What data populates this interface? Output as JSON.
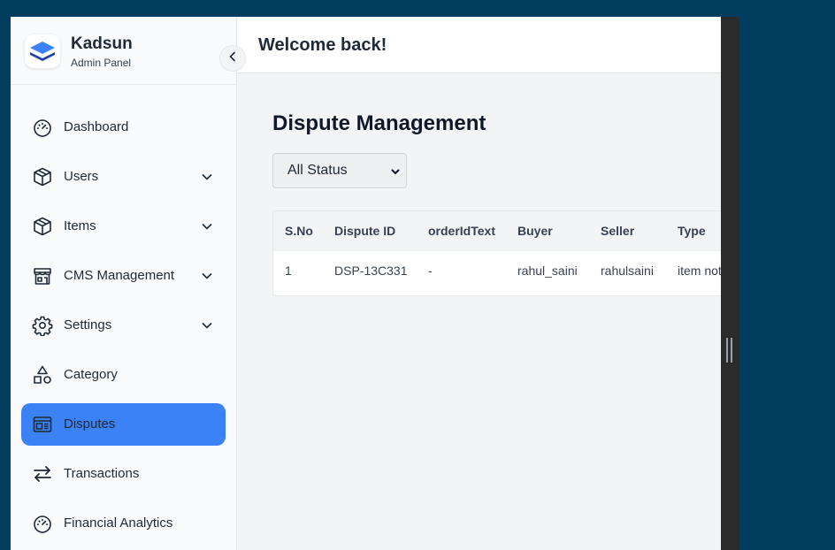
{
  "brand": {
    "name": "Kadsun",
    "subtitle": "Admin Panel"
  },
  "sidebar": {
    "items": [
      {
        "label": "Dashboard",
        "icon": "gauge-icon",
        "has_submenu": false,
        "active": false
      },
      {
        "label": "Users",
        "icon": "box-icon",
        "has_submenu": true,
        "active": false
      },
      {
        "label": "Items",
        "icon": "box-icon",
        "has_submenu": true,
        "active": false
      },
      {
        "label": "CMS Management",
        "icon": "store-icon",
        "has_submenu": true,
        "active": false
      },
      {
        "label": "Settings",
        "icon": "gear-icon",
        "has_submenu": true,
        "active": false
      },
      {
        "label": "Category",
        "icon": "shapes-icon",
        "has_submenu": false,
        "active": false
      },
      {
        "label": "Disputes",
        "icon": "layout-panel-icon",
        "has_submenu": false,
        "active": true
      },
      {
        "label": "Transactions",
        "icon": "arrows-exchange-icon",
        "has_submenu": false,
        "active": false
      },
      {
        "label": "Financial Analytics",
        "icon": "gauge-icon",
        "has_submenu": false,
        "active": false
      }
    ]
  },
  "header": {
    "welcome": "Welcome back!"
  },
  "main": {
    "title": "Dispute Management",
    "status_filter": {
      "selected": "All Status"
    },
    "table": {
      "columns": [
        "S.No",
        "Dispute ID",
        "orderIdText",
        "Buyer",
        "Seller",
        "Type"
      ],
      "rows": [
        [
          "1",
          "DSP-13C331",
          "-",
          "rahul_saini",
          "rahulsaini",
          "item not received"
        ]
      ]
    }
  },
  "colors": {
    "page_background": "#003d5e",
    "accent": "#3b82f6",
    "sidebar_background": "#f8fafc",
    "content_background": "#f3f4f6"
  }
}
